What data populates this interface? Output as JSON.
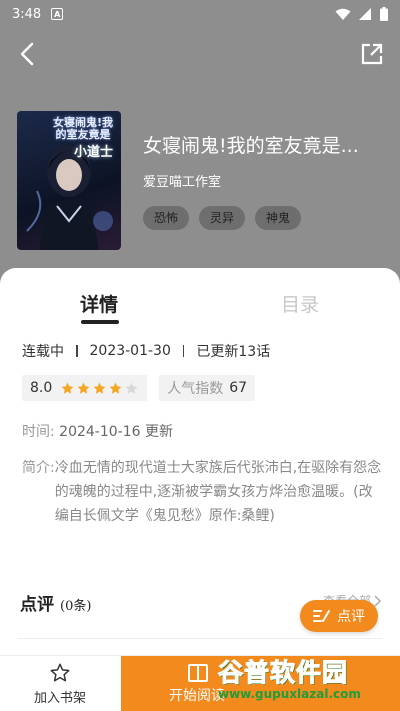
{
  "status_bar": {
    "time": "3:48",
    "notif_glyph": "A"
  },
  "nav": {
    "back_icon": "back-arrow-icon",
    "share_icon": "share-icon"
  },
  "book": {
    "cover_title_text": "女寝闹鬼!我的室友竟是",
    "cover_title_text2": "小道士",
    "title": "女寝闹鬼!我的室友竟是...",
    "author": "爱豆喵工作室",
    "tags": [
      "恐怖",
      "灵异",
      "神鬼"
    ]
  },
  "tabs": {
    "detail": "详情",
    "toc": "目录"
  },
  "meta": {
    "status": "连载中",
    "date": "2023-01-30",
    "updated": "已更新13话"
  },
  "rating": {
    "score": "8.0",
    "stars_full": 4,
    "stars_total": 5,
    "popularity_label": "人气指数",
    "popularity_value": "67"
  },
  "time_row": {
    "label": "时间:",
    "value": "2024-10-16 更新"
  },
  "intro": {
    "label": "简介:",
    "text": "冷血无情的现代道士大家族后代张沛白,在驱除有怨念的魂魄的过程中,逐渐被学霸女孩方烨治愈温暖。(改编自长佩文学《鬼见愁》原作:桑鲤)"
  },
  "review": {
    "title": "点评",
    "count": "(0条)",
    "more": "查看全部",
    "button": "点评"
  },
  "bottom": {
    "shelf_label": "加入书架",
    "read_label": "开始阅读"
  },
  "watermark": {
    "main": "谷普软件园",
    "url": "www.gupuxlazal.com"
  },
  "colors": {
    "accent": "#f28a1e",
    "star": "#f5a623",
    "header_bg": "#8e8e8e"
  }
}
